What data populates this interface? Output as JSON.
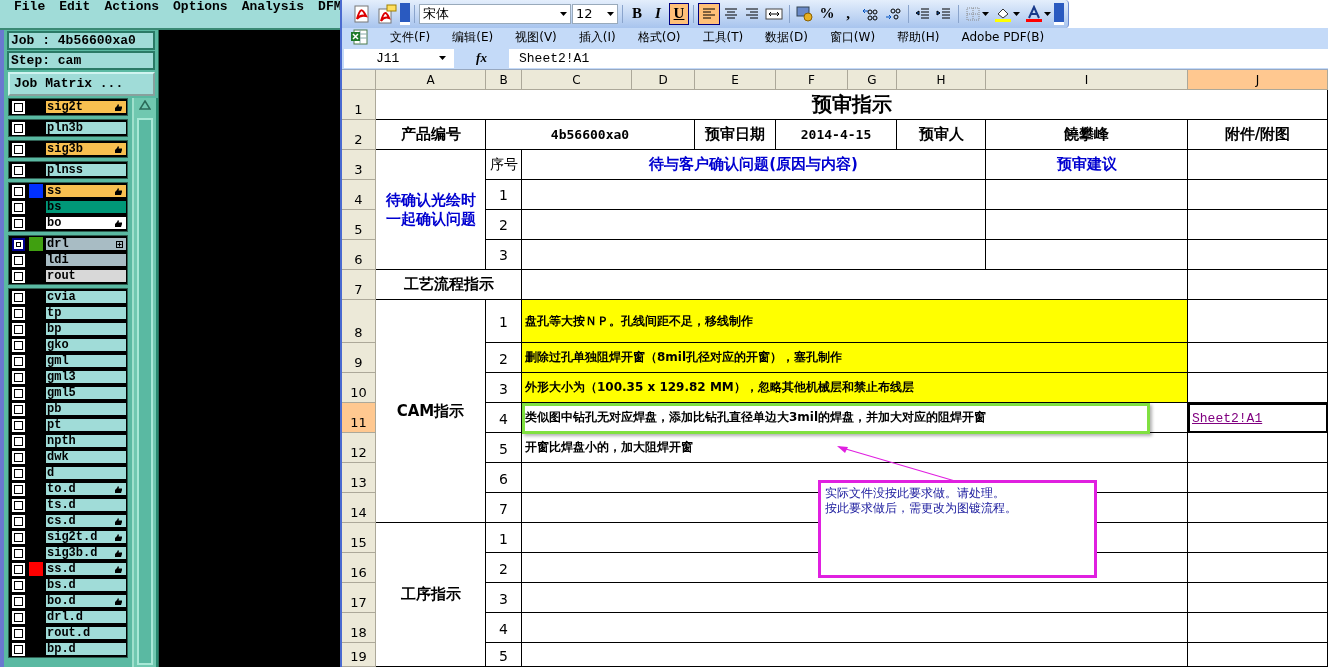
{
  "cam_panel": {
    "menu": [
      "File",
      "Edit",
      "Actions",
      "Options",
      "Analysis",
      "DFM"
    ],
    "job": "Job : 4b56600xa0",
    "step": "Step: cam",
    "matrix_button": "Job Matrix ...",
    "layer_groups": [
      {
        "layers": [
          {
            "name": "sig2t",
            "color": "#f8c050",
            "marked": true,
            "attached": false,
            "selected": false
          }
        ]
      },
      {
        "layers": [
          {
            "name": "pln3b",
            "color": "#a0dcd8",
            "marked": false,
            "attached": false,
            "selected": false
          }
        ]
      },
      {
        "layers": [
          {
            "name": "sig3b",
            "color": "#f8c050",
            "marked": true,
            "attached": false,
            "selected": false
          }
        ]
      },
      {
        "layers": [
          {
            "name": "plnss",
            "color": "#a0dcd8",
            "marked": false,
            "attached": false,
            "selected": false
          }
        ]
      },
      {
        "layers": [
          {
            "name": "ss",
            "color": "#f8c050",
            "swatch": {
              "color": "#0030ff"
            },
            "marked": true,
            "attached": false,
            "selected": false
          },
          {
            "name": "bs",
            "color": "#009878",
            "marked": false,
            "attached": false,
            "selected": false
          },
          {
            "name": "bo",
            "color": "#ffffff",
            "marked": true,
            "attached": false,
            "selected": false
          }
        ]
      },
      {
        "layers": [
          {
            "name": "drl",
            "color": "#a8bcc4",
            "swatch": {
              "color": "#40a010"
            },
            "marked": false,
            "attached": true,
            "selected": true
          },
          {
            "name": "ldi",
            "color": "#a8bcc4",
            "marked": false,
            "attached": false,
            "selected": false
          },
          {
            "name": "rout",
            "color": "#d8d8d8",
            "marked": false,
            "attached": false,
            "selected": false
          }
        ]
      },
      {
        "layers": [
          {
            "name": "cvia",
            "color": "#a0dcd8",
            "marked": false,
            "attached": false,
            "selected": false
          },
          {
            "name": "tp",
            "color": "#a0dcd8",
            "marked": false,
            "attached": false,
            "selected": false
          },
          {
            "name": "bp",
            "color": "#a0dcd8",
            "marked": false,
            "attached": false,
            "selected": false
          },
          {
            "name": "gko",
            "color": "#a0dcd8",
            "marked": false,
            "attached": false,
            "selected": false
          },
          {
            "name": "gml",
            "color": "#a0dcd8",
            "marked": false,
            "attached": false,
            "selected": false
          },
          {
            "name": "gml3",
            "color": "#a0dcd8",
            "marked": false,
            "attached": false,
            "selected": false
          },
          {
            "name": "gml5",
            "color": "#a0dcd8",
            "marked": false,
            "attached": false,
            "selected": false
          },
          {
            "name": "pb",
            "color": "#a0dcd8",
            "marked": false,
            "attached": false,
            "selected": false
          },
          {
            "name": "pt",
            "color": "#a0dcd8",
            "marked": false,
            "attached": false,
            "selected": false
          },
          {
            "name": "npth",
            "color": "#a0dcd8",
            "marked": false,
            "attached": false,
            "selected": false
          },
          {
            "name": "dwk",
            "color": "#a0dcd8",
            "marked": false,
            "attached": false,
            "selected": false
          },
          {
            "name": "d",
            "color": "#a0dcd8",
            "marked": false,
            "attached": false,
            "selected": false
          },
          {
            "name": "to.d",
            "color": "#a0dcd8",
            "marked": true,
            "attached": false,
            "selected": false
          },
          {
            "name": "ts.d",
            "color": "#a0dcd8",
            "marked": false,
            "attached": false,
            "selected": false
          },
          {
            "name": "cs.d",
            "color": "#a0dcd8",
            "marked": true,
            "attached": false,
            "selected": false
          },
          {
            "name": "sig2t.d",
            "color": "#a0dcd8",
            "marked": true,
            "attached": false,
            "selected": false
          },
          {
            "name": "sig3b.d",
            "color": "#a0dcd8",
            "marked": true,
            "attached": false,
            "selected": false
          },
          {
            "name": "ss.d",
            "color": "#a0dcd8",
            "swatch": {
              "color": "#ff0000"
            },
            "marked": true,
            "attached": false,
            "selected": false
          },
          {
            "name": "bs.d",
            "color": "#a0dcd8",
            "marked": false,
            "attached": false,
            "selected": false
          },
          {
            "name": "bo.d",
            "color": "#a0dcd8",
            "marked": true,
            "attached": false,
            "selected": false
          },
          {
            "name": "drl.d",
            "color": "#a0dcd8",
            "marked": false,
            "attached": false,
            "selected": false
          },
          {
            "name": "rout.d",
            "color": "#a0dcd8",
            "marked": false,
            "attached": false,
            "selected": false
          },
          {
            "name": "bp.d",
            "color": "#a0dcd8",
            "marked": false,
            "attached": false,
            "selected": false
          }
        ]
      }
    ]
  },
  "excel": {
    "toolbar": [
      {
        "kind": "pdf",
        "on": false
      },
      {
        "kind": "pdf-comment",
        "on": false
      },
      {
        "kind": "overflow",
        "on": false
      },
      {
        "kind": "font",
        "value": "宋体"
      },
      {
        "kind": "size",
        "value": "12"
      },
      {
        "kind": "letter",
        "label": "B",
        "on": false
      },
      {
        "kind": "letter",
        "label": "I",
        "on": false
      },
      {
        "kind": "letter",
        "label": "U",
        "on": true
      },
      {
        "kind": "align-left",
        "on": true
      },
      {
        "kind": "align-center",
        "on": false
      },
      {
        "kind": "align-right",
        "on": false
      },
      {
        "kind": "merge",
        "on": false
      },
      {
        "kind": "currency",
        "on": false
      },
      {
        "kind": "letter",
        "label": "%",
        "on": false
      },
      {
        "kind": "letter",
        "label": ",",
        "on": false
      },
      {
        "kind": "decimal-more",
        "on": false
      },
      {
        "kind": "decimal-less",
        "on": false
      },
      {
        "kind": "outdent",
        "on": false
      },
      {
        "kind": "indent",
        "on": false
      },
      {
        "kind": "borders",
        "on": false
      },
      {
        "kind": "fill-color",
        "on": false
      },
      {
        "kind": "font-color",
        "on": false
      },
      {
        "kind": "overflow",
        "on": false
      }
    ],
    "menu": [
      "文件(F)",
      "编辑(E)",
      "视图(V)",
      "插入(I)",
      "格式(O)",
      "工具(T)",
      "数据(D)",
      "窗口(W)",
      "帮助(H)",
      "Adobe PDF(B)"
    ],
    "name_box": "J11",
    "fx_label": "fx",
    "formula": "Sheet2!A1",
    "columns": [
      {
        "label": "A",
        "selected": false
      },
      {
        "label": "B",
        "selected": false
      },
      {
        "label": "C",
        "selected": false
      },
      {
        "label": "D",
        "selected": false
      },
      {
        "label": "E",
        "selected": false
      },
      {
        "label": "F",
        "selected": false
      },
      {
        "label": "G",
        "selected": false
      },
      {
        "label": "H",
        "selected": false
      },
      {
        "label": "I",
        "selected": false
      },
      {
        "label": "J",
        "selected": true
      }
    ],
    "rows": [
      {
        "label": "1",
        "selected": false
      },
      {
        "label": "2",
        "selected": false
      },
      {
        "label": "3",
        "selected": false
      },
      {
        "label": "4",
        "selected": false
      },
      {
        "label": "5",
        "selected": false
      },
      {
        "label": "6",
        "selected": false
      },
      {
        "label": "7",
        "selected": false
      },
      {
        "label": "8",
        "selected": false
      },
      {
        "label": "9",
        "selected": false
      },
      {
        "label": "10",
        "selected": false
      },
      {
        "label": "11",
        "selected": true
      },
      {
        "label": "12",
        "selected": false
      },
      {
        "label": "13",
        "selected": false
      },
      {
        "label": "14",
        "selected": false
      },
      {
        "label": "15",
        "selected": false
      },
      {
        "label": "16",
        "selected": false
      },
      {
        "label": "17",
        "selected": false
      },
      {
        "label": "18",
        "selected": false
      },
      {
        "label": "19",
        "selected": false
      }
    ],
    "cells": [
      {
        "kind": "title",
        "text": "预审指示",
        "selected": false
      },
      {
        "kind": "label",
        "text": "产品编号",
        "selected": false
      },
      {
        "kind": "value",
        "text": "4b56600xa0",
        "selected": false
      },
      {
        "kind": "label",
        "text": "预审日期",
        "selected": false
      },
      {
        "kind": "value",
        "text": "2014-4-15",
        "selected": false
      },
      {
        "kind": "label",
        "text": "预审人",
        "selected": false
      },
      {
        "kind": "label",
        "text": "饒攀峰",
        "selected": false
      },
      {
        "kind": "label",
        "text": "附件/附图",
        "selected": false
      },
      {
        "kind": "blue",
        "text": "待确认光绘时一起确认问题",
        "selected": false
      },
      {
        "kind": "plain",
        "text": "序号",
        "selected": false
      },
      {
        "kind": "blue",
        "text": "待与客户确认问题(原因与内容)",
        "selected": false
      },
      {
        "kind": "blue",
        "text": "预审建议",
        "selected": false
      },
      {
        "kind": "plain",
        "text": "1",
        "selected": false
      },
      {
        "kind": "plain",
        "text": "2",
        "selected": false
      },
      {
        "kind": "plain",
        "text": "3",
        "selected": false
      },
      {
        "kind": "label",
        "text": "工艺流程指示",
        "selected": false
      },
      {
        "kind": "label",
        "text": "CAM指示",
        "selected": false
      },
      {
        "kind": "number",
        "text": "1",
        "selected": false
      },
      {
        "kind": "yellow",
        "text": "盘孔等大按ＮＰ。孔线间距不足，移线制作",
        "selected": false
      },
      {
        "kind": "number",
        "text": "2",
        "selected": false
      },
      {
        "kind": "yellow",
        "text": "删除过孔单独阻焊开窗（8mil孔径对应的开窗），塞孔制作",
        "selected": false
      },
      {
        "kind": "number",
        "text": "3",
        "selected": false
      },
      {
        "kind": "yellow",
        "text": "外形大小为（100.35 x 129.82 MM），忽略其他机械层和禁止布线层",
        "selected": false
      },
      {
        "kind": "number",
        "text": "4",
        "selected": false
      },
      {
        "kind": "note",
        "text": "类似图中钻孔无对应焊盘，添加比钻孔直径单边大3mil的焊盘，并加大对应的阻焊开窗",
        "selected": false
      },
      {
        "kind": "link",
        "text": "Sheet2!A1",
        "selected": true
      },
      {
        "kind": "number",
        "text": "5",
        "selected": false
      },
      {
        "kind": "note",
        "text": "开窗比焊盘小的，加大阻焊开窗",
        "selected": false
      },
      {
        "kind": "number",
        "text": "6",
        "selected": false
      },
      {
        "kind": "number",
        "text": "7",
        "selected": false
      },
      {
        "kind": "label",
        "text": "工序指示",
        "selected": false
      },
      {
        "kind": "number",
        "text": "1",
        "selected": false
      },
      {
        "kind": "number",
        "text": "2",
        "selected": false
      },
      {
        "kind": "number",
        "text": "3",
        "selected": false
      },
      {
        "kind": "number",
        "text": "4",
        "selected": false
      },
      {
        "kind": "number",
        "text": "5",
        "selected": false
      }
    ],
    "comment": {
      "lines": [
        "实际文件没按此要求做。请处理。",
        "按此要求做后，需更改为图镀流程。"
      ]
    }
  }
}
